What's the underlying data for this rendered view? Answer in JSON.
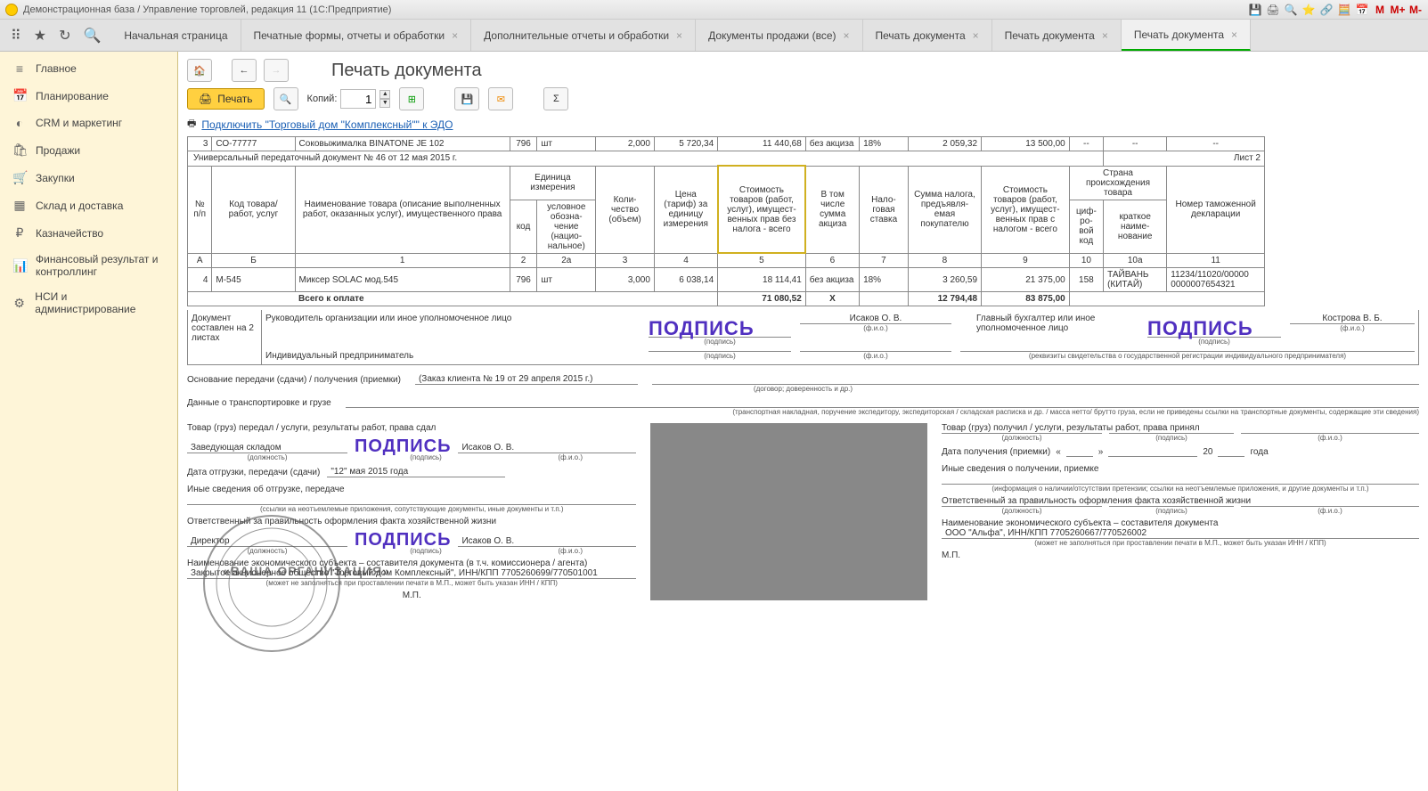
{
  "app_title": "Демонстрационная база / Управление торговлей, редакция 11  (1С:Предприятие)",
  "tabs": [
    {
      "label": "Начальная страница",
      "closable": false
    },
    {
      "label": "Печатные формы, отчеты и обработки",
      "closable": true
    },
    {
      "label": "Дополнительные отчеты и обработки",
      "closable": true
    },
    {
      "label": "Документы продажи (все)",
      "closable": true
    },
    {
      "label": "Печать документа",
      "closable": true
    },
    {
      "label": "Печать документа",
      "closable": true
    },
    {
      "label": "Печать документа",
      "closable": true,
      "active": true
    }
  ],
  "sidebar": [
    {
      "icon": "≡",
      "label": "Главное"
    },
    {
      "icon": "📅",
      "label": "Планирование"
    },
    {
      "icon": "◐",
      "label": "CRM и маркетинг"
    },
    {
      "icon": "🛍",
      "label": "Продажи"
    },
    {
      "icon": "🛒",
      "label": "Закупки"
    },
    {
      "icon": "▦",
      "label": "Склад и доставка"
    },
    {
      "icon": "₽",
      "label": "Казначейство"
    },
    {
      "icon": "📊",
      "label": "Финансовый результат и контроллинг"
    },
    {
      "icon": "⚙",
      "label": "НСИ и администрирование"
    }
  ],
  "page_title": "Печать документа",
  "toolbar": {
    "print": "Печать",
    "copies_label": "Копий:",
    "copies_value": "1"
  },
  "edo_link": "Подключить \"Торговый дом \"Комплексный\"\" к ЭДО",
  "prev_row": {
    "num": "3",
    "code": "СО-77777",
    "name": "Соковыжималка  BINATONE JE 102",
    "unit_code": "796",
    "unit": "шт",
    "qty": "2,000",
    "price": "5 720,34",
    "cost_no_tax": "11 440,68",
    "excise": "без акциза",
    "tax_rate": "18%",
    "tax_sum": "2 059,32",
    "cost_with_tax": "13 500,00",
    "digit_code": "--",
    "country": "--",
    "decl": "--"
  },
  "doc_header_line": "Универсальный передаточный документ № 46 от 12 мая 2015 г.",
  "sheet_label": "Лист 2",
  "headers": {
    "num": "№ п/п",
    "code": "Код товара/ работ, услуг",
    "name": "Наименование товара (описание выполненных работ, оказанных услуг), имущественного права",
    "unit_group": "Единица измерения",
    "unit_code": "код",
    "unit_name": "условное обозна-чение (нацио-нальное)",
    "qty": "Коли-чество (объем)",
    "price": "Цена (тариф) за единицу измерения",
    "cost_no_tax": "Стоимость товаров (работ, услуг), имущест-венных прав без налога - всего",
    "excise": "В том числе сумма акциза",
    "tax_rate": "Нало-говая ставка",
    "tax_sum": "Сумма налога, предъявля-емая покупателю",
    "cost_with_tax": "Стоимость товаров (работ, услуг), имущест-венных прав с налогом - всего",
    "country_group": "Страна происхождения товара",
    "digit_code": "циф-ро-вой код",
    "country_name": "краткое наиме-нование",
    "decl": "Номер таможенной декларации"
  },
  "col_nums": [
    "А",
    "Б",
    "1",
    "2",
    "2а",
    "3",
    "4",
    "5",
    "6",
    "7",
    "8",
    "9",
    "10",
    "10а",
    "11"
  ],
  "data_row": {
    "num": "4",
    "code": "М-545",
    "name": "Миксер SOLAC мод.545",
    "unit_code": "796",
    "unit": "шт",
    "qty": "3,000",
    "price": "6 038,14",
    "cost_no_tax": "18 114,41",
    "excise": "без акциза",
    "tax_rate": "18%",
    "tax_sum": "3 260,59",
    "cost_with_tax": "21 375,00",
    "digit_code": "158",
    "country": "ТАЙВАНЬ (КИТАЙ)",
    "decl": "11234/11020/00000 0000007654321"
  },
  "total": {
    "label": "Всего к оплате",
    "cost_no_tax": "71 080,52",
    "excise": "Х",
    "tax_sum": "12 794,48",
    "cost_with_tax": "83 875,00"
  },
  "signatures": {
    "doc_composed": "Документ составлен на 2 листах",
    "head_org": "Руководитель организации или иное уполномоченное лицо",
    "chief_acc": "Главный бухгалтер или иное уполномоченное лицо",
    "ip": "Индивидуальный предприниматель",
    "isakov": "Исаков О. В.",
    "kostrova": "Кострова В. Б.",
    "podpis": "ПОДПИСЬ",
    "podpis_cap": "(подпись)",
    "fio_cap": "(ф.и.о.)",
    "rekviz_cap": "(реквизиты свидетельства о государственной  регистрации индивидуального предпринимателя)"
  },
  "basis": {
    "label": "Основание передачи (сдачи) / получения (приемки)",
    "value": "(Заказ клиента № 19 от 29 апреля 2015 г.)",
    "caption": "(договор; доверенность и др.)"
  },
  "transport": {
    "label": "Данные о транспортировке и грузе",
    "caption": "(транспортная накладная, поручение экспедитору, экспедиторская / складская расписка и др. / масса нетто/ брутто груза, если не приведены ссылки на транспортные документы, содержащие эти сведения)"
  },
  "left_block": {
    "l1": "Товар (груз) передал / услуги, результаты работ, права сдал",
    "post": "Заведующая складом",
    "date_label": "Дата отгрузки, передачи (сдачи)",
    "date_val": "\"12\" мая 2015 года",
    "other": "Иные сведения об отгрузке, передаче",
    "other_cap": "(ссылки на неотъемлемые приложения, сопутствующие документы, иные документы и т.п.)",
    "resp": "Ответственный за правильность оформления факта хозяйственной жизни",
    "director": "Директор",
    "subj": "Наименование экономического субъекта – составителя документа (в т.ч. комиссионера / агента)",
    "zao": "Закрытое акционерное общество \"Торговый дом Комплексный\", ИНН/КПП 7705260699/770501001",
    "maynot": "(может не заполняться при проставлении печати в М.П., может быть указан ИНН / КПП)",
    "mp": "М.П.",
    "stamp_org": "«ВАША ОРГАНИЗАЦИЯ»"
  },
  "right_block": {
    "l1": "Товар (груз) получил / услуги, результаты работ, права принял",
    "date_label": "Дата получения (приемки)",
    "date_val_prefix": "«",
    "date_val_mid": "»",
    "year_prefix": "20",
    "year_suffix": "года",
    "other": "Иные сведения о получении, приемке",
    "other_cap": "(информация о наличии/отсутствии претензии; ссылки на неотъемлемые приложения, и другие  документы и т.п.)",
    "resp": "Ответственный за правильность оформления факта хозяйственной жизни",
    "subj": "Наименование экономического субъекта – составителя документа",
    "ooo": "ООО \"Альфа\", ИНН/КПП 7705260667/770526002",
    "maynot": "(может не заполняться при проставлении печати в М.П., может быть указан ИНН / КПП)",
    "mp": "М.П."
  },
  "captions": {
    "position": "(должность)"
  }
}
